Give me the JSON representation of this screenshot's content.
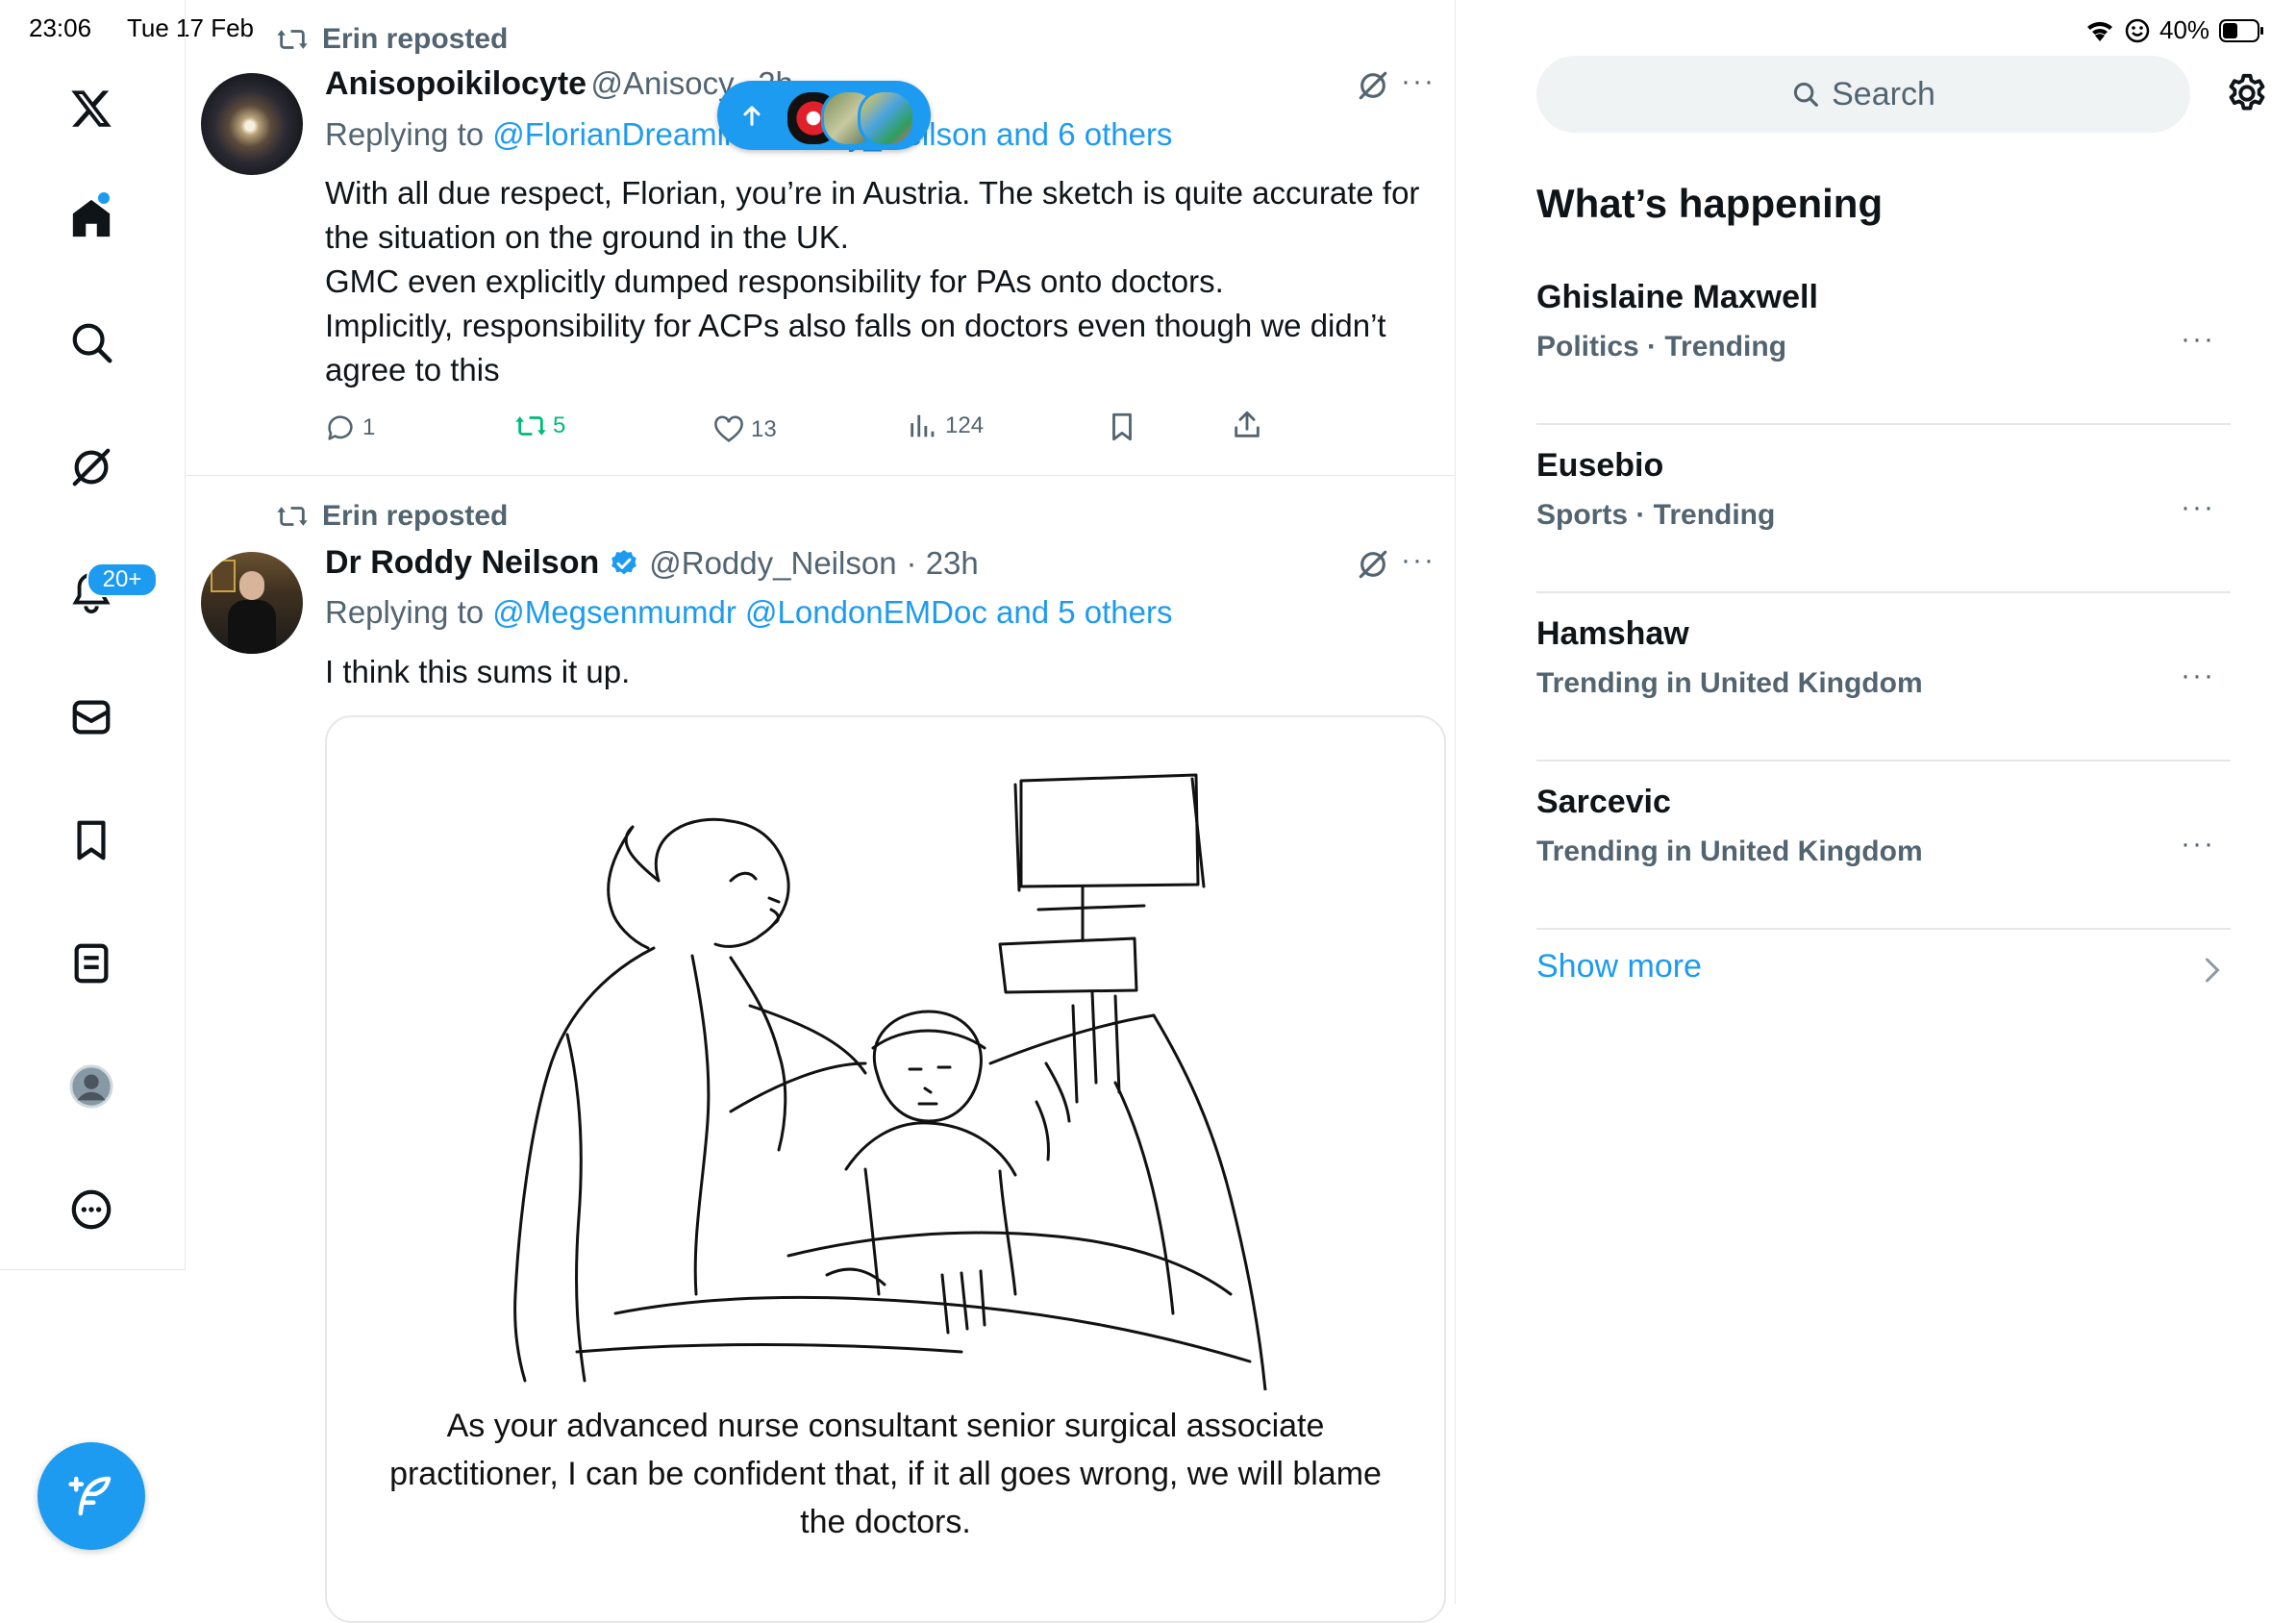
{
  "status_bar": {
    "time": "23:06",
    "date": "Tue 17 Feb",
    "battery": "40%"
  },
  "nav": {
    "notifications_badge": "20+",
    "icons": [
      "x-logo-icon",
      "home-icon",
      "search-icon",
      "grok-icon",
      "notifications-icon",
      "messages-icon",
      "bookmarks-icon",
      "lists-icon",
      "profile-icon",
      "more-icon"
    ]
  },
  "new_posts_pill": {
    "icon": "arrow-up-icon"
  },
  "tweets": [
    {
      "repost_label": "Erin reposted",
      "name": "Anisopoikilocyte",
      "handle": "@Anisocy",
      "time": "· 2h",
      "replying_prefix": "Replying to",
      "replying_to": "@FlorianDreamii @Roddy_Neilson and 6 others",
      "text": "With all due respect, Florian, you’re in Austria. The sketch is quite accurate for the situation on the ground in the UK.\nGMC even explicitly dumped responsibility for PAs onto doctors.\nImplicitly, responsibility for ACPs also falls on doctors even though we didn’t agree to this",
      "replies": "1",
      "reposts": "5",
      "likes": "13",
      "views": "124"
    },
    {
      "repost_label": "Erin reposted",
      "name": "Dr Roddy Neilson",
      "handle": "@Roddy_Neilson",
      "time": "· 23h",
      "replying_prefix": "Replying to",
      "replying_to": "@Megsenmumdr @LondonEMDoc and 5 others",
      "text": "I think this sums it up.",
      "image_caption": "As your advanced nurse consultant senior surgical associate practitioner, I can be confident that, if it all goes wrong, we will blame the doctors."
    }
  ],
  "right": {
    "search_placeholder": "Search",
    "section_title": "What’s happening",
    "trends": [
      {
        "name": "Ghislaine Maxwell",
        "meta": "Politics · Trending"
      },
      {
        "name": "Eusebio",
        "meta": "Sports · Trending"
      },
      {
        "name": "Hamshaw",
        "meta": "Trending in United Kingdom"
      },
      {
        "name": "Sarcevic",
        "meta": "Trending in United Kingdom"
      }
    ],
    "more_label": "···",
    "show_more": "Show more"
  },
  "colors": {
    "accent": "#1d9bf0",
    "repost_green": "#00ba7c",
    "muted": "#536471",
    "border": "#e7e7e7"
  }
}
